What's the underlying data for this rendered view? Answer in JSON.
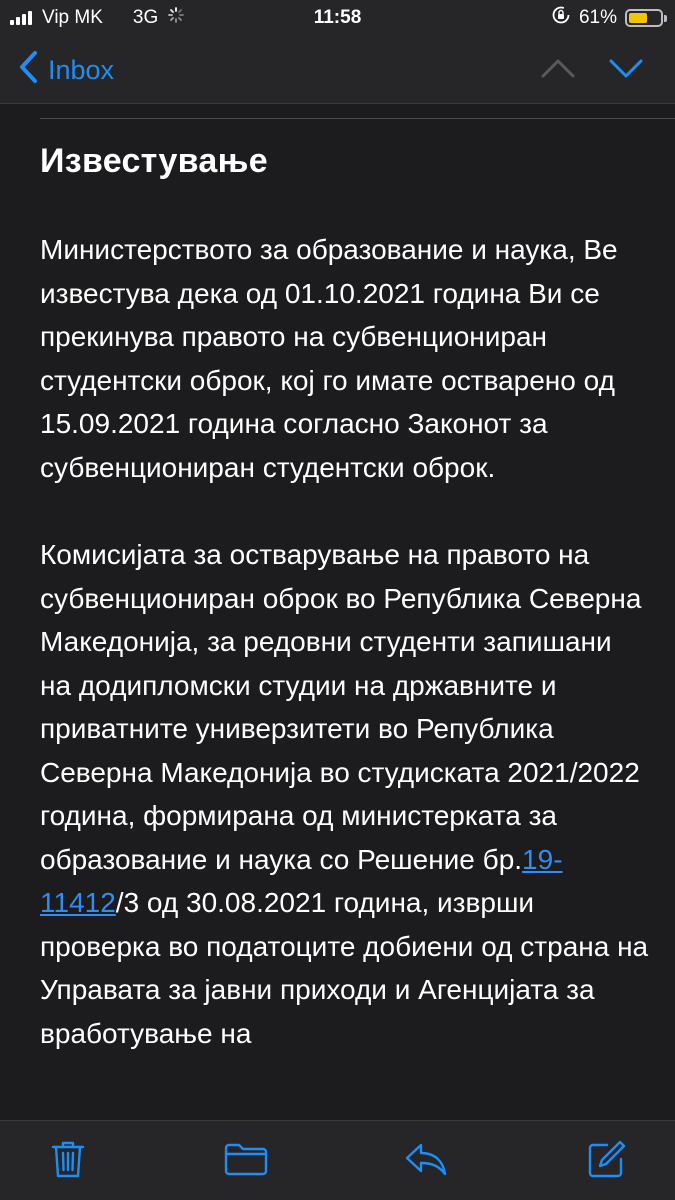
{
  "status_bar": {
    "carrier": "Vip MK",
    "network": "3G",
    "time": "11:58",
    "battery_percent": "61%",
    "battery_level": 0.61
  },
  "nav": {
    "back_label": "Inbox"
  },
  "email": {
    "subject": "Известување",
    "paragraph_1": "Министерството за образование и наука, Ве известува дека од 01.10.2021 година Ви се прекинува правото на субвенциониран студентски оброк, кој го имате остварено од 15.09.2021 година согласно Законот за субвенциониран студентски оброк.",
    "paragraph_2_before_link": "Комисијата за остварување на правото на субвенциониран оброк во Република Северна Македонија, за редовни студенти запишани на додипломски студии на државните и приватните универзитети во Република Северна Македонија во студиската 2021/2022 година, формирана од министерката за образование и наука со Решение бр.",
    "paragraph_2_link": "19-11412",
    "paragraph_2_after_link": "/3 од 30.08.2021 година, изврши проверка во податоците добиени од страна на Управата за јавни приходи и Агенцијата за вработување на"
  },
  "colors": {
    "accent": "#1e8ef5",
    "background": "#1c1c1e",
    "bar": "#262628",
    "battery": "#f5c400"
  },
  "icons": {
    "trash": "trash-icon",
    "folder": "folder-icon",
    "reply": "reply-icon",
    "compose": "compose-icon"
  }
}
